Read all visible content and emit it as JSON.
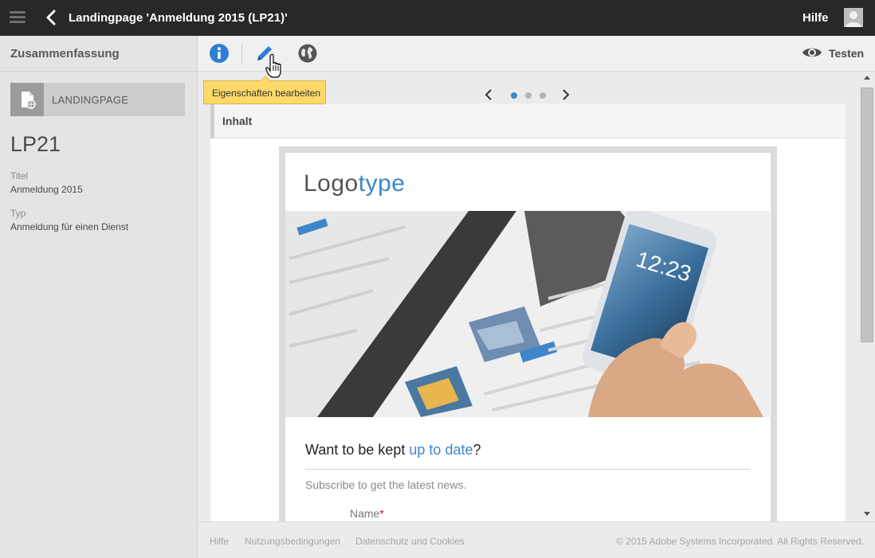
{
  "header": {
    "title": "Landingpage 'Anmeldung 2015 (LP21)'",
    "help_label": "Hilfe",
    "menu_icon": "hamburger-menu-icon",
    "back_icon": "chevron-left-icon",
    "avatar_icon": "user-avatar-icon"
  },
  "left_panel": {
    "summary_title": "Zusammenfassung",
    "type_label": "LANDINGPAGE",
    "type_icon": "landing-page-icon",
    "id": "LP21",
    "fields": [
      {
        "label": "Titel",
        "value": "Anmeldung 2015"
      },
      {
        "label": "Typ",
        "value": "Anmeldung für einen Dienst"
      }
    ]
  },
  "toolbar": {
    "info_icon": "info-icon",
    "edit_icon": "pencil-icon",
    "web_icon": "globe-icon",
    "test_label": "Testen",
    "test_icon": "eye-icon"
  },
  "tooltip": {
    "text": "Eigenschaften bearbeiten"
  },
  "pager": {
    "total": 3,
    "active": 1
  },
  "section": {
    "title": "Inhalt"
  },
  "email": {
    "logo_dark": "Logo",
    "logo_blue": "type",
    "headline_start": "Want to be kept ",
    "headline_link": "up to date",
    "headline_end": "?",
    "subtext": "Subscribe to get the latest news.",
    "name_label": "Name",
    "required_mark": "*"
  },
  "footer": {
    "links": [
      "Hilfe",
      "Nutzungsbedingungen",
      "Datenschutz und Cookies"
    ],
    "copyright": "© 2015 Adobe Systems Incorporated. All Rights Reserved."
  },
  "colors": {
    "topbar": "#282828",
    "accent_blue": "#3d86c9",
    "tooltip_yellow": "#fcd968",
    "required_red": "#d0021b"
  }
}
